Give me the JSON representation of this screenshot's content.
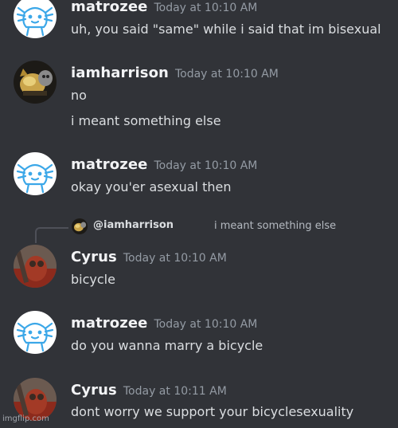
{
  "messages": [
    {
      "username": "matrozee",
      "timestamp": "Today at 10:10 AM",
      "avatar_icon": "axolotl-avatar-icon",
      "lines": [
        "uh, you said \"same\" while i said that im bisexual"
      ]
    },
    {
      "username": "iamharrison",
      "timestamp": "Today at 10:10 AM",
      "avatar_icon": "gold-cat-avatar-icon",
      "lines": [
        "no",
        "i meant something else"
      ]
    },
    {
      "username": "matrozee",
      "timestamp": "Today at 10:10 AM",
      "avatar_icon": "axolotl-avatar-icon",
      "lines": [
        "okay you'er asexual then"
      ]
    },
    {
      "reply_to": {
        "mention": "@iamharrison",
        "text": "i meant something else",
        "avatar_icon": "gold-cat-avatar-icon"
      },
      "username": "Cyrus",
      "timestamp": "Today at 10:10 AM",
      "avatar_icon": "pyro-avatar-icon",
      "lines": [
        "bicycle"
      ]
    },
    {
      "username": "matrozee",
      "timestamp": "Today at 10:10 AM",
      "avatar_icon": "axolotl-avatar-icon",
      "lines": [
        "do you wanna marry a bicycle"
      ]
    },
    {
      "username": "Cyrus",
      "timestamp": "Today at 10:11 AM",
      "avatar_icon": "pyro-avatar-icon",
      "lines": [
        "dont worry we support your bicyclesexuality"
      ]
    }
  ],
  "watermark": "imgflip.com",
  "colors": {
    "background": "#313338",
    "username": "#f2f3f5",
    "timestamp": "#949ba4",
    "message_text": "#dbdee1",
    "axolotl_avatar_bg": "#ffffff",
    "axolotl_stroke": "#3ba7e8"
  }
}
